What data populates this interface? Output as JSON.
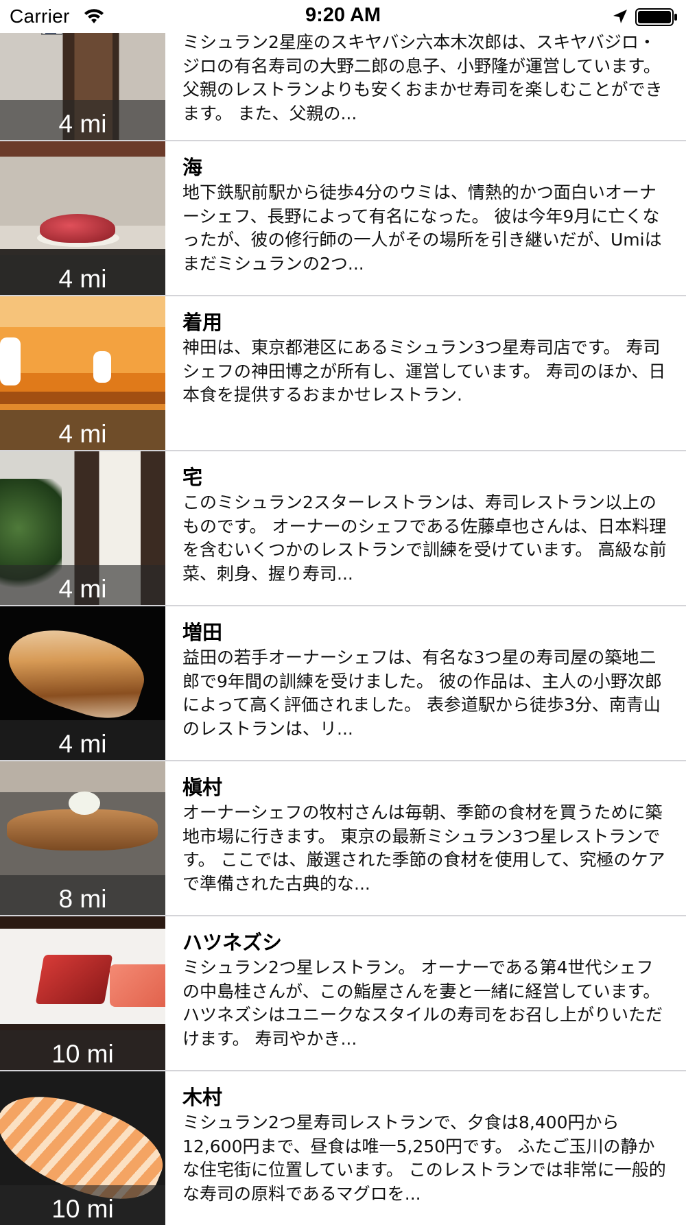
{
  "status_bar": {
    "carrier": "Carrier",
    "time": "9:20 AM",
    "icons": [
      "wifi-icon",
      "location-icon",
      "battery-icon"
    ]
  },
  "restaurants": [
    {
      "name": "",
      "distance": "4 mi",
      "description": "ミシュラン2星座のスキヤバシ六本木次郎は、スキヤバジロ・ジロの有名寿司の大野二郎の息子、小野隆が運営しています。 父親のレストランよりも安くおまかせ寿司を楽しむことができます。 また、父親の..."
    },
    {
      "name": "海",
      "distance": "4 mi",
      "description": "地下鉄駅前駅から徒歩4分のウミは、情熱的かつ面白いオーナーシェフ、長野によって有名になった。 彼は今年9月に亡くなったが、彼の修行師の一人がその場所を引き継いだが、Umiはまだミシュランの2つ..."
    },
    {
      "name": "着用",
      "distance": "4 mi",
      "description": "神田は、東京都港区にあるミシュラン3つ星寿司店です。 寿司シェフの神田博之が所有し、運営しています。 寿司のほか、日本食を提供するおまかせレストラン."
    },
    {
      "name": "宅",
      "distance": "4 mi",
      "description": "このミシュラン2スターレストランは、寿司レストラン以上のものです。 オーナーのシェフである佐藤卓也さんは、日本料理を含むいくつかのレストランで訓練を受けています。 高級な前菜、刺身、握り寿司..."
    },
    {
      "name": "増田",
      "distance": "4 mi",
      "description": "益田の若手オーナーシェフは、有名な3つ星の寿司屋の築地二郎で9年間の訓練を受けました。 彼の作品は、主人の小野次郎によって高く評価されました。 表参道駅から徒歩3分、南青山のレストランは、リ..."
    },
    {
      "name": "槇村",
      "distance": "8 mi",
      "description": "オーナーシェフの牧村さんは毎朝、季節の食材を買うために築地市場に行きます。 東京の最新ミシュラン3つ星レストランです。 ここでは、厳選された季節の食材を使用して、究極のケアで準備された古典的な..."
    },
    {
      "name": "ハツネズシ",
      "distance": "10 mi",
      "description": "ミシュラン2つ星レストラン。 オーナーである第4世代シェフの中島桂さんが、この鮨屋さんを妻と一緒に経営しています。 ハツネズシはユニークなスタイルの寿司をお召し上がりいただけます。 寿司やかき..."
    },
    {
      "name": "木村",
      "distance": "10 mi",
      "description": "ミシュラン2つ星寿司レストランで、夕食は8,400円から12,600円まで、昼食は唯一5,250円です。 ふたご玉川の静かな住宅街に位置しています。 このレストランでは非常に一般的な寿司の原料であるマグロを..."
    }
  ]
}
